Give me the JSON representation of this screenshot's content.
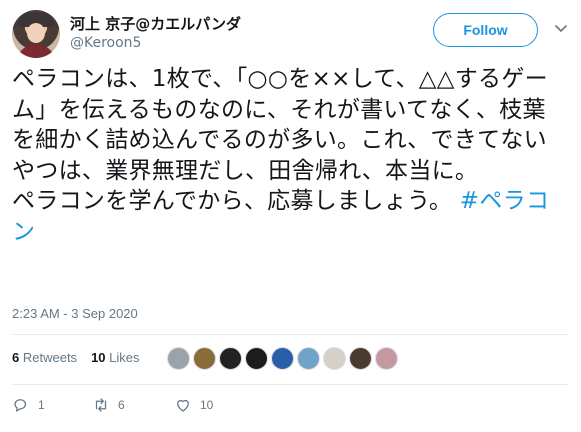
{
  "user": {
    "display_name": "河上 京子@カエルパンダ",
    "handle": "@Keroon5"
  },
  "follow_button_label": "Follow",
  "tweet": {
    "text": "ペラコンは、1枚で、「○○を××して、△△するゲーム」を伝えるものなのに、それが書いてなく、枝葉を細かく詰め込んでるのが多い。これ、できてないやつは、業界無理だし、田舎帰れ、本当に。\nペラコンを学んでから、応募しましょう。",
    "hashtag": "#ペラコン",
    "timestamp": "2:23 AM - 3 Sep 2020"
  },
  "stats": {
    "retweets_count": "6",
    "retweets_label": "Retweets",
    "likes_count": "10",
    "likes_label": "Likes"
  },
  "likers": [
    {
      "color": "#9aa3ab"
    },
    {
      "color": "#8a6b3a"
    },
    {
      "color": "#222222"
    },
    {
      "color": "#1c1c1c"
    },
    {
      "color": "#2a5ea8"
    },
    {
      "color": "#6fa3c7"
    },
    {
      "color": "#d7d0c8"
    },
    {
      "color": "#4b3b2f"
    },
    {
      "color": "#c49aa0"
    }
  ],
  "actions": {
    "reply_count": "1",
    "retweet_count": "6",
    "like_count": "10"
  },
  "colors": {
    "accent": "#1b95e0",
    "muted": "#657786",
    "text": "#14171a"
  }
}
